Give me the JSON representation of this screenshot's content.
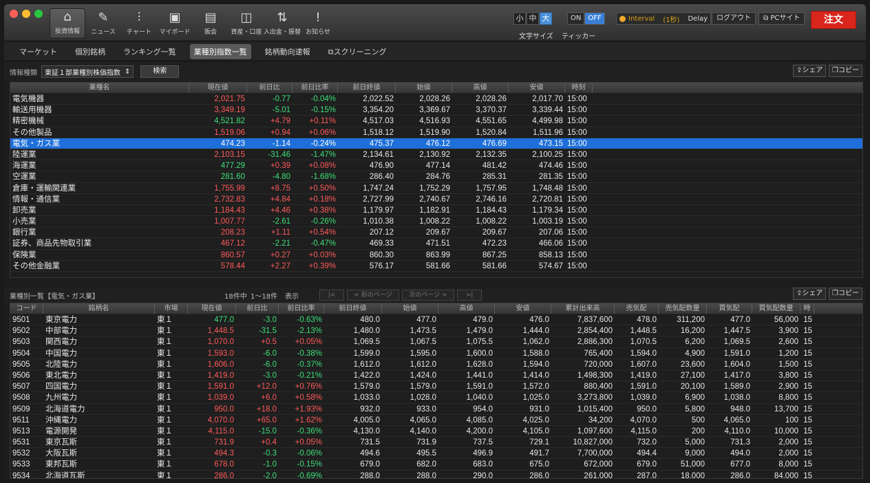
{
  "toolbar": {
    "nav": [
      {
        "label": "投資情報",
        "icon": "⌂"
      },
      {
        "label": "ニュース",
        "icon": "✎"
      },
      {
        "label": "チャート",
        "icon": "⫶"
      },
      {
        "label": "マイボード",
        "icon": "▣"
      },
      {
        "label": "販会",
        "icon": "▤"
      },
      {
        "label": "資産・口座",
        "icon": "◫"
      },
      {
        "label": "入出金・振替",
        "icon": "⇅"
      },
      {
        "label": "お知らせ",
        "icon": "!"
      }
    ],
    "font_sizes": [
      "小",
      "中",
      "大"
    ],
    "font_size_label": "文字サイズ",
    "ticker_label": "ティッカー",
    "on": "ON",
    "off": "OFF",
    "interval": "Interval",
    "interval_value": "(1秒)",
    "delay": "Delay",
    "logout": "ログアウト",
    "pc_site": "PCサイト",
    "order": "注文"
  },
  "subtabs": [
    "マーケット",
    "個別銘柄",
    "ランキング一覧",
    "業種別指数一覧",
    "銘柄動向速報",
    "スクリーニング"
  ],
  "info": {
    "label": "情報種類",
    "select_value": "東証１部業種別株価指数",
    "search": "検索",
    "share": "シェア",
    "copy": "コピー"
  },
  "sector_table": {
    "headers": [
      "業種名",
      "現在値",
      "前日比",
      "前日比率",
      "前日終値",
      "始値",
      "高値",
      "安値",
      "時刻"
    ],
    "selected_row": 4,
    "rows": [
      [
        "電気機器",
        "2,021.75",
        "-0.77",
        "-0.04%",
        "2,022.52",
        "2,028.26",
        "2,028.26",
        "2,017.70",
        "15:00",
        "red"
      ],
      [
        "輸送用機器",
        "3,349.19",
        "-5.01",
        "-0.15%",
        "3,354.20",
        "3,369.67",
        "3,370.37",
        "3,339.44",
        "15:00",
        "red"
      ],
      [
        "精密機械",
        "4,521.82",
        "+4.79",
        "+0.11%",
        "4,517.03",
        "4,516.93",
        "4,551.65",
        "4,499.98",
        "15:00",
        "grn"
      ],
      [
        "その他製品",
        "1,519.06",
        "+0.94",
        "+0.06%",
        "1,518.12",
        "1,519.90",
        "1,520.84",
        "1,511.96",
        "15:00",
        "red"
      ],
      [
        "電気・ガス業",
        "474.23",
        "-1.14",
        "-0.24%",
        "475.37",
        "476.12",
        "476.69",
        "473.15",
        "15:00",
        "red"
      ],
      [
        "陸運業",
        "2,103.15",
        "-31.46",
        "-1.47%",
        "2,134.61",
        "2,130.92",
        "2,132.35",
        "2,100.25",
        "15:00",
        "red"
      ],
      [
        "海運業",
        "477.29",
        "+0.39",
        "+0.08%",
        "476.90",
        "477.14",
        "481.42",
        "474.46",
        "15:00",
        "grn"
      ],
      [
        "空運業",
        "281.60",
        "-4.80",
        "-1.68%",
        "286.40",
        "284.76",
        "285.31",
        "281.35",
        "15:00",
        "grn"
      ],
      [
        "倉庫・運輸関連業",
        "1,755.99",
        "+8.75",
        "+0.50%",
        "1,747.24",
        "1,752.29",
        "1,757.95",
        "1,748.48",
        "15:00",
        "red"
      ],
      [
        "情報・通信業",
        "2,732.83",
        "+4.84",
        "+0.18%",
        "2,727.99",
        "2,740.67",
        "2,746.16",
        "2,720.81",
        "15:00",
        "red"
      ],
      [
        "卸売業",
        "1,184.43",
        "+4.46",
        "+0.38%",
        "1,179.97",
        "1,182.91",
        "1,184.43",
        "1,179.34",
        "15:00",
        "red"
      ],
      [
        "小売業",
        "1,007.77",
        "-2.61",
        "-0.26%",
        "1,010.38",
        "1,008.22",
        "1,008.22",
        "1,003.19",
        "15:00",
        "red"
      ],
      [
        "銀行業",
        "208.23",
        "+1.11",
        "+0.54%",
        "207.12",
        "209.67",
        "209.67",
        "207.06",
        "15:00",
        "red"
      ],
      [
        "証券、商品先物取引業",
        "467.12",
        "-2.21",
        "-0.47%",
        "469.33",
        "471.51",
        "472.23",
        "466.06",
        "15:00",
        "red"
      ],
      [
        "保険業",
        "860.57",
        "+0.27",
        "+0.03%",
        "860.30",
        "863.99",
        "867.25",
        "858.13",
        "15:00",
        "red"
      ],
      [
        "その他金融業",
        "578.44",
        "+2.27",
        "+0.39%",
        "576.17",
        "581.66",
        "581.66",
        "574.67",
        "15:00",
        "red"
      ]
    ]
  },
  "list_bar": {
    "title": "業種別一覧【電気・ガス業】",
    "count": "18件中",
    "range": "1〜18件",
    "show": "表示",
    "first": "|<",
    "prev": "< 前のページ",
    "next": "次のページ >",
    "last": ">|",
    "share": "シェア",
    "copy": "コピー"
  },
  "stock_table": {
    "headers": [
      "コード",
      "銘柄名",
      "市場",
      "現在値",
      "前日比",
      "前日比率",
      "前日終値",
      "始値",
      "高値",
      "安値",
      "累計出来高",
      "売気配",
      "売気配数量",
      "買気配",
      "買気配数量",
      "時"
    ],
    "rows": [
      [
        "9501",
        "東京電力",
        "東１",
        "477.0",
        "-3.0",
        "-0.63%",
        "480.0",
        "477.0",
        "479.0",
        "476.0",
        "7,837,600",
        "478.0",
        "311,200",
        "477.0",
        "56,000",
        "15",
        "grn"
      ],
      [
        "9502",
        "中部電力",
        "東１",
        "1,448.5",
        "-31.5",
        "-2.13%",
        "1,480.0",
        "1,473.5",
        "1,479.0",
        "1,444.0",
        "2,854,400",
        "1,448.5",
        "16,200",
        "1,447.5",
        "3,900",
        "15",
        "red"
      ],
      [
        "9503",
        "関西電力",
        "東１",
        "1,070.0",
        "+0.5",
        "+0.05%",
        "1,069.5",
        "1,067.5",
        "1,075.5",
        "1,062.0",
        "2,886,300",
        "1,070.5",
        "6,200",
        "1,069.5",
        "2,600",
        "15",
        "red"
      ],
      [
        "9504",
        "中国電力",
        "東１",
        "1,593.0",
        "-6.0",
        "-0.38%",
        "1,599.0",
        "1,595.0",
        "1,600.0",
        "1,588.0",
        "765,400",
        "1,594.0",
        "4,900",
        "1,591.0",
        "1,200",
        "15",
        "red"
      ],
      [
        "9505",
        "北陸電力",
        "東１",
        "1,606.0",
        "-6.0",
        "-0.37%",
        "1,612.0",
        "1,612.0",
        "1,628.0",
        "1,594.0",
        "720,000",
        "1,607.0",
        "23,600",
        "1,604.0",
        "1,500",
        "15",
        "red"
      ],
      [
        "9506",
        "東北電力",
        "東１",
        "1,419.0",
        "-3.0",
        "-0.21%",
        "1,422.0",
        "1,424.0",
        "1,441.0",
        "1,414.0",
        "1,498,300",
        "1,419.0",
        "27,100",
        "1,417.0",
        "3,800",
        "15",
        "red"
      ],
      [
        "9507",
        "四国電力",
        "東１",
        "1,591.0",
        "+12.0",
        "+0.76%",
        "1,579.0",
        "1,579.0",
        "1,591.0",
        "1,572.0",
        "880,400",
        "1,591.0",
        "20,100",
        "1,589.0",
        "2,900",
        "15",
        "red"
      ],
      [
        "9508",
        "九州電力",
        "東１",
        "1,039.0",
        "+6.0",
        "+0.58%",
        "1,033.0",
        "1,028.0",
        "1,040.0",
        "1,025.0",
        "3,273,800",
        "1,039.0",
        "6,900",
        "1,038.0",
        "8,800",
        "15",
        "red"
      ],
      [
        "9509",
        "北海道電力",
        "東１",
        "950.0",
        "+18.0",
        "+1.93%",
        "932.0",
        "933.0",
        "954.0",
        "931.0",
        "1,015,400",
        "950.0",
        "5,800",
        "948.0",
        "13,700",
        "15",
        "red"
      ],
      [
        "9511",
        "沖縄電力",
        "東１",
        "4,070.0",
        "+65.0",
        "+1.62%",
        "4,005.0",
        "4,065.0",
        "4,085.0",
        "4,025.0",
        "34,200",
        "4,070.0",
        "500",
        "4,065.0",
        "100",
        "15",
        "red"
      ],
      [
        "9513",
        "電源開発",
        "東１",
        "4,115.0",
        "-15.0",
        "-0.36%",
        "4,130.0",
        "4,140.0",
        "4,200.0",
        "4,105.0",
        "1,097,600",
        "4,115.0",
        "200",
        "4,110.0",
        "10,000",
        "15",
        "red"
      ],
      [
        "9531",
        "東京瓦斯",
        "東１",
        "731.9",
        "+0.4",
        "+0.05%",
        "731.5",
        "731.9",
        "737.5",
        "729.1",
        "10,827,000",
        "732.0",
        "5,000",
        "731.3",
        "2,000",
        "15",
        "red"
      ],
      [
        "9532",
        "大阪瓦斯",
        "東１",
        "494.3",
        "-0.3",
        "-0.06%",
        "494.6",
        "495.5",
        "496.9",
        "491.7",
        "7,700,000",
        "494.4",
        "9,000",
        "494.0",
        "2,000",
        "15",
        "red"
      ],
      [
        "9533",
        "東邦瓦斯",
        "東１",
        "678.0",
        "-1.0",
        "-0.15%",
        "679.0",
        "682.0",
        "683.0",
        "675.0",
        "672,000",
        "679.0",
        "51,000",
        "677.0",
        "8,000",
        "15",
        "red"
      ],
      [
        "9534",
        "北海道瓦斯",
        "東１",
        "286.0",
        "-2.0",
        "-0.69%",
        "288.0",
        "288.0",
        "290.0",
        "286.0",
        "261,000",
        "287.0",
        "18,000",
        "286.0",
        "84,000",
        "15",
        "red"
      ]
    ]
  }
}
